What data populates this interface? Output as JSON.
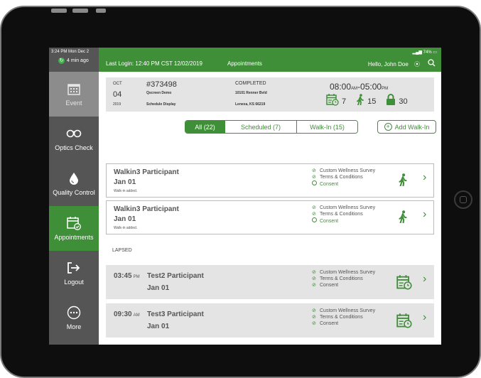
{
  "status": {
    "time": "3:24 PM  Mon Dec 2",
    "battery": "74%",
    "sync_label": "4 min ago"
  },
  "sidebar": {
    "items": [
      {
        "label": "Event",
        "icon": "calendar-grid-icon"
      },
      {
        "label": "Optics Check",
        "icon": "glasses-icon"
      },
      {
        "label": "Quality Control",
        "icon": "droplet-icon"
      },
      {
        "label": "Appointments",
        "icon": "calendar-check-icon"
      },
      {
        "label": "Logout",
        "icon": "logout-icon"
      },
      {
        "label": "More",
        "icon": "more-icon"
      }
    ]
  },
  "header": {
    "last_login": "Last Login: 12:40 PM CST 12/02/2019",
    "section": "Appointments",
    "greeting": "Hello, John Doe"
  },
  "event": {
    "month": "OCT",
    "day": "04",
    "year": "2019",
    "id": "#373498",
    "client": "Qscreen Demo",
    "type": "Schedule Display",
    "status": "COMPLETED",
    "address_line1": "10101 Renner Bvld",
    "address_line2": "Lenexa, KS 66219",
    "time_start": "08:00",
    "time_start_ampm": "AM",
    "time_sep": "-",
    "time_end": "05:00",
    "time_end_ampm": "PM",
    "scheduled_count": "7",
    "walkin_count": "15",
    "locked_count": "30"
  },
  "filters": {
    "tabs": [
      "All (22)",
      "Scheduled (7)",
      "Walk-In (15)"
    ],
    "active": 0,
    "add_walkin": "Add Walk-In"
  },
  "appointments": [
    {
      "name": "Walkin3 Participant",
      "date": "Jan 01",
      "note": "Walk-in added.",
      "surveys": [
        "Custom Wellness Survey",
        "Terms & Conditions",
        "Consent"
      ]
    },
    {
      "name": "Walkin3 Participant",
      "date": "Jan 01",
      "note": "Walk-in added.",
      "surveys": [
        "Custom Wellness Survey",
        "Terms & Conditions",
        "Consent"
      ]
    }
  ],
  "lapsed_label": "LAPSED",
  "lapsed": [
    {
      "time": "03:45",
      "ampm": "PM",
      "name": "Test2 Participant",
      "date": "Jan 01",
      "surveys": [
        "Custom Wellness Survey",
        "Terms & Conditions",
        "Consent"
      ]
    },
    {
      "time": "09:30",
      "ampm": "AM",
      "name": "Test3 Participant",
      "date": "Jan 01",
      "surveys": [
        "Custom Wellness Survey",
        "Terms & Conditions",
        "Consent"
      ]
    }
  ],
  "colors": {
    "brand_green": "#3f8f38",
    "sidebar_gray": "#555555",
    "event_gray": "#8c8c8c",
    "panel_gray": "#e4e4e4"
  }
}
